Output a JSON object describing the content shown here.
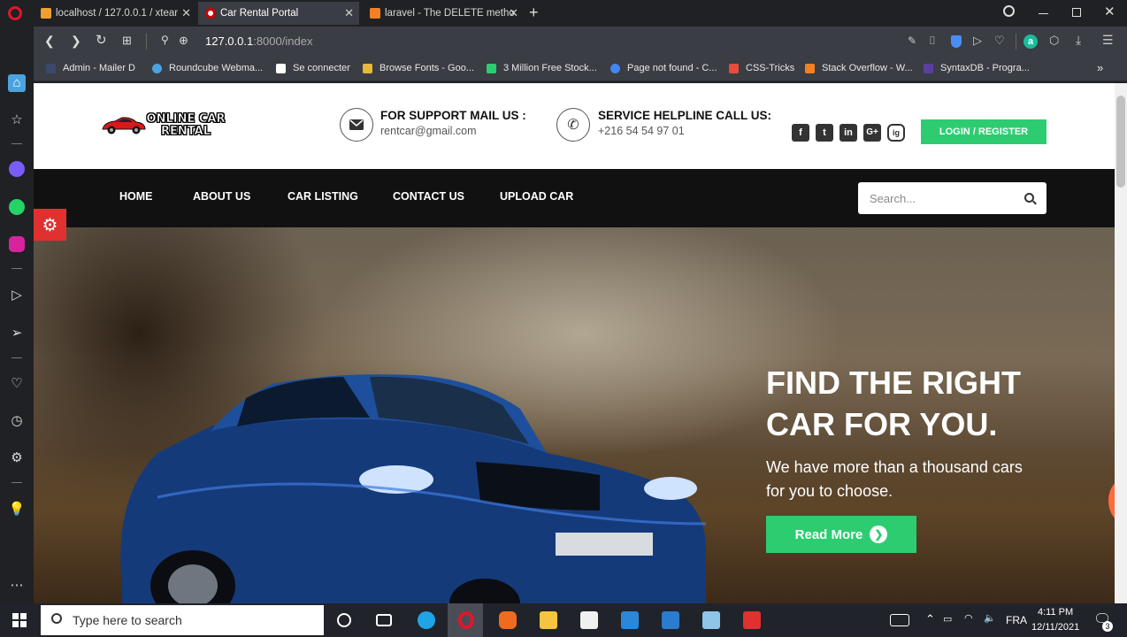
{
  "browser": {
    "tabs": [
      {
        "title": "localhost / 127.0.0.1 / xtear",
        "active": false
      },
      {
        "title": "Car Rental Portal",
        "active": true
      },
      {
        "title": "laravel - The DELETE metho",
        "active": false
      }
    ],
    "new_tab": "+",
    "url_host": "127.0.0.1",
    "url_path": ":8000/index",
    "bookmarks": [
      {
        "label": "Admin - Mailer D",
        "color": "#3b4a6b"
      },
      {
        "label": "Roundcube Webma...",
        "color": "#4aa3df"
      },
      {
        "label": "Se connecter",
        "color": "#ffffff"
      },
      {
        "label": "Browse Fonts - Goo...",
        "color": "#e8b83a"
      },
      {
        "label": "3 Million Free Stock...",
        "color": "#2ecc71"
      },
      {
        "label": "Page not found - C...",
        "color": "#4285f4"
      },
      {
        "label": "CSS-Tricks",
        "color": "#e74c3c"
      },
      {
        "label": "Stack Overflow - W...",
        "color": "#f48024"
      },
      {
        "label": "SyntaxDB - Progra...",
        "color": "#5b3fa0"
      }
    ],
    "bookmarks_more": "»"
  },
  "site": {
    "logo_line1": "ONLINE CAR",
    "logo_line2": "RENTAL",
    "support_title": "FOR SUPPORT MAIL US :",
    "support_email": "rentcar@gmail.com",
    "helpline_title": "SERVICE HELPLINE CALL US:",
    "helpline_phone": "+216 54 54 97 01",
    "social": [
      "f",
      "t",
      "in",
      "G+",
      "ig"
    ],
    "login_label": "LOGIN / REGISTER",
    "nav": [
      "HOME",
      "ABOUT US",
      "CAR LISTING",
      "CONTACT US",
      "UPLOAD CAR"
    ],
    "search_placeholder": "Search...",
    "hero_title_line1": "FIND THE RIGHT",
    "hero_title_line2": "CAR FOR YOU.",
    "hero_sub": "We have more than a thousand cars for you to choose.",
    "read_more": "Read More",
    "accent": "#2ecc71",
    "settings_color": "#e03131"
  },
  "taskbar": {
    "search_placeholder": "Type here to search",
    "lang": "FRA",
    "time": "4:11 PM",
    "date": "12/11/2021",
    "notifications": "3"
  }
}
